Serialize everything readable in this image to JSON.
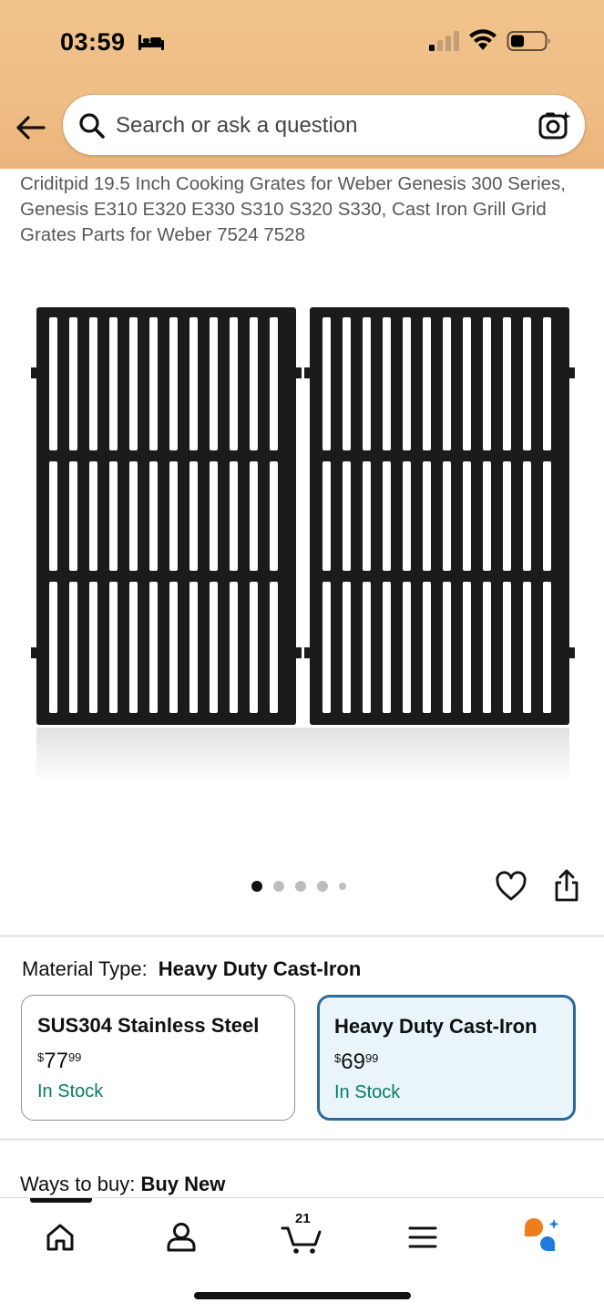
{
  "status_bar": {
    "time": "03:59"
  },
  "search": {
    "placeholder": "Search or ask a question"
  },
  "product": {
    "title": "Criditpid 19.5 Inch Cooking Grates for Weber Genesis 300 Series, Genesis E310 E320 E330 S310 S320 S330, Cast Iron Grill Grid Grates Parts for Weber 7524 7528"
  },
  "carousel": {
    "count": 5,
    "active_index": 0
  },
  "material": {
    "label": "Material Type:",
    "selected": "Heavy Duty Cast-Iron",
    "options": [
      {
        "name": "SUS304 Stainless Steel",
        "currency": "$",
        "price_whole": "77",
        "price_fraction": "99",
        "stock": "In Stock",
        "selected": false
      },
      {
        "name": "Heavy Duty Cast-Iron",
        "currency": "$",
        "price_whole": "69",
        "price_fraction": "99",
        "stock": "In Stock",
        "selected": true
      }
    ]
  },
  "ways_to_buy": {
    "label": "Ways to buy:",
    "value": "Buy New"
  },
  "bottom_nav": {
    "cart_count": "21",
    "items": [
      "home-icon",
      "account-icon",
      "cart-icon",
      "menu-icon",
      "rufus-ai-icon"
    ]
  },
  "colors": {
    "header_bg": "#efbd86",
    "selected_border": "#2d6a99",
    "selected_bg": "#eaf5fb",
    "in_stock": "#067d62",
    "ai_orange": "#f07c1c",
    "ai_blue": "#1f7ae0"
  }
}
